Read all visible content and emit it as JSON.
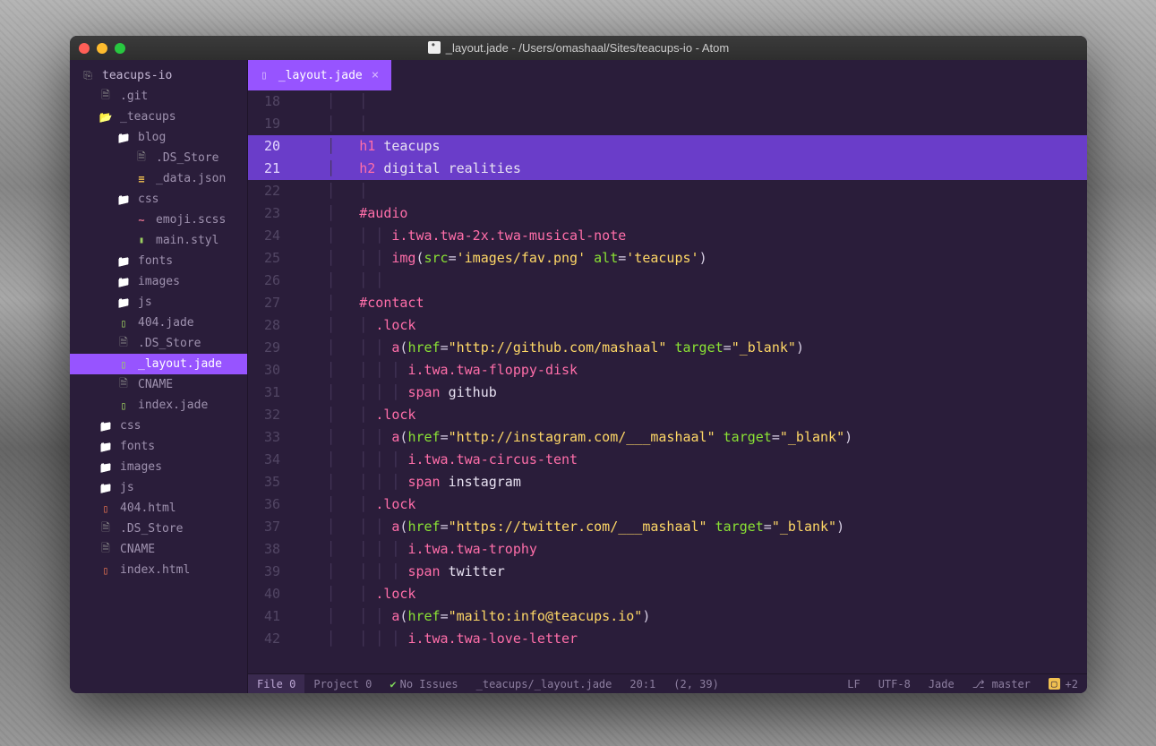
{
  "window": {
    "title": "_layout.jade - /Users/omashaal/Sites/teacups-io - Atom"
  },
  "sidebar": {
    "root": "teacups-io",
    "nodes": [
      {
        "depth": 2,
        "icon": "file-icon",
        "label": ".git"
      },
      {
        "depth": 2,
        "icon": "folder-open",
        "label": "_teacups"
      },
      {
        "depth": 3,
        "icon": "folder-icon",
        "label": "blog"
      },
      {
        "depth": 4,
        "icon": "file-icon",
        "label": ".DS_Store"
      },
      {
        "depth": 4,
        "icon": "db-icon",
        "label": "_data.json"
      },
      {
        "depth": 3,
        "icon": "folder-icon",
        "label": "css"
      },
      {
        "depth": 4,
        "icon": "scss-icon",
        "label": "emoji.scss"
      },
      {
        "depth": 4,
        "icon": "styl-icon",
        "label": "main.styl"
      },
      {
        "depth": 3,
        "icon": "folder-icon",
        "label": "fonts"
      },
      {
        "depth": 3,
        "icon": "folder-icon",
        "label": "images"
      },
      {
        "depth": 3,
        "icon": "folder-icon",
        "label": "js"
      },
      {
        "depth": 3,
        "icon": "jade-icon",
        "label": "404.jade"
      },
      {
        "depth": 3,
        "icon": "file-icon",
        "label": ".DS_Store"
      },
      {
        "depth": 3,
        "icon": "jade-icon",
        "label": "_layout.jade",
        "selected": true
      },
      {
        "depth": 3,
        "icon": "file-icon",
        "label": "CNAME"
      },
      {
        "depth": 3,
        "icon": "jade-icon",
        "label": "index.jade"
      },
      {
        "depth": 2,
        "icon": "folder-icon",
        "label": "css"
      },
      {
        "depth": 2,
        "icon": "folder-icon",
        "label": "fonts"
      },
      {
        "depth": 2,
        "icon": "folder-icon",
        "label": "images"
      },
      {
        "depth": 2,
        "icon": "folder-icon",
        "label": "js"
      },
      {
        "depth": 2,
        "icon": "html-icon",
        "label": "404.html"
      },
      {
        "depth": 2,
        "icon": "file-icon",
        "label": ".DS_Store"
      },
      {
        "depth": 2,
        "icon": "file-icon",
        "label": "CNAME"
      },
      {
        "depth": 2,
        "icon": "html-icon",
        "label": "index.html"
      }
    ]
  },
  "tab": {
    "label": "_layout.jade"
  },
  "code": {
    "first_line": 18,
    "lines": [
      {
        "n": 18,
        "segs": [
          {
            "c": "guide",
            "t": "    │   │"
          }
        ]
      },
      {
        "n": 19,
        "segs": [
          {
            "c": "guide",
            "t": "    │   │"
          }
        ]
      },
      {
        "n": 20,
        "hl": true,
        "segs": [
          {
            "c": "guide",
            "t": "    │   "
          },
          {
            "c": "tag",
            "t": "h1"
          },
          {
            "c": "txt",
            "t": " teacups"
          }
        ]
      },
      {
        "n": 21,
        "hl": true,
        "segs": [
          {
            "c": "guide",
            "t": "    │   "
          },
          {
            "c": "tag",
            "t": "h2"
          },
          {
            "c": "txt",
            "t": " digital realities"
          }
        ]
      },
      {
        "n": 22,
        "segs": [
          {
            "c": "guide",
            "t": "    │   │"
          }
        ]
      },
      {
        "n": 23,
        "segs": [
          {
            "c": "guide",
            "t": "    │   "
          },
          {
            "c": "id",
            "t": "#audio"
          }
        ]
      },
      {
        "n": 24,
        "segs": [
          {
            "c": "guide",
            "t": "    │   │ │ "
          },
          {
            "c": "cls",
            "t": "i.twa.twa-2x.twa-musical-note"
          }
        ]
      },
      {
        "n": 25,
        "segs": [
          {
            "c": "guide",
            "t": "    │   │ │ "
          },
          {
            "c": "tag",
            "t": "img"
          },
          {
            "c": "pn",
            "t": "("
          },
          {
            "c": "attr",
            "t": "src"
          },
          {
            "c": "eq",
            "t": "="
          },
          {
            "c": "str",
            "t": "'images/fav.png'"
          },
          {
            "c": "txt",
            "t": " "
          },
          {
            "c": "attr",
            "t": "alt"
          },
          {
            "c": "eq",
            "t": "="
          },
          {
            "c": "str",
            "t": "'teacups'"
          },
          {
            "c": "pn",
            "t": ")"
          }
        ]
      },
      {
        "n": 26,
        "segs": [
          {
            "c": "guide",
            "t": "    │   │ │"
          }
        ]
      },
      {
        "n": 27,
        "segs": [
          {
            "c": "guide",
            "t": "    │   "
          },
          {
            "c": "id",
            "t": "#contact"
          }
        ]
      },
      {
        "n": 28,
        "segs": [
          {
            "c": "guide",
            "t": "    │   │ "
          },
          {
            "c": "cls",
            "t": ".lock"
          }
        ]
      },
      {
        "n": 29,
        "segs": [
          {
            "c": "guide",
            "t": "    │   │ │ "
          },
          {
            "c": "tag",
            "t": "a"
          },
          {
            "c": "pn",
            "t": "("
          },
          {
            "c": "attr",
            "t": "href"
          },
          {
            "c": "eq",
            "t": "="
          },
          {
            "c": "str",
            "t": "\"http://github.com/mashaal\""
          },
          {
            "c": "txt",
            "t": " "
          },
          {
            "c": "attr",
            "t": "target"
          },
          {
            "c": "eq",
            "t": "="
          },
          {
            "c": "str",
            "t": "\"_blank\""
          },
          {
            "c": "pn",
            "t": ")"
          }
        ]
      },
      {
        "n": 30,
        "segs": [
          {
            "c": "guide",
            "t": "    │   │ │ │ "
          },
          {
            "c": "cls",
            "t": "i.twa.twa-floppy-disk"
          }
        ]
      },
      {
        "n": 31,
        "segs": [
          {
            "c": "guide",
            "t": "    │   │ │ │ "
          },
          {
            "c": "tag",
            "t": "span"
          },
          {
            "c": "txt",
            "t": " github"
          }
        ]
      },
      {
        "n": 32,
        "segs": [
          {
            "c": "guide",
            "t": "    │   │ "
          },
          {
            "c": "cls",
            "t": ".lock"
          }
        ]
      },
      {
        "n": 33,
        "segs": [
          {
            "c": "guide",
            "t": "    │   │ │ "
          },
          {
            "c": "tag",
            "t": "a"
          },
          {
            "c": "pn",
            "t": "("
          },
          {
            "c": "attr",
            "t": "href"
          },
          {
            "c": "eq",
            "t": "="
          },
          {
            "c": "str",
            "t": "\"http://instagram.com/___mashaal\""
          },
          {
            "c": "txt",
            "t": " "
          },
          {
            "c": "attr",
            "t": "target"
          },
          {
            "c": "eq",
            "t": "="
          },
          {
            "c": "str",
            "t": "\"_blank\""
          },
          {
            "c": "pn",
            "t": ")"
          }
        ]
      },
      {
        "n": 34,
        "segs": [
          {
            "c": "guide",
            "t": "    │   │ │ │ "
          },
          {
            "c": "cls",
            "t": "i.twa.twa-circus-tent"
          }
        ]
      },
      {
        "n": 35,
        "segs": [
          {
            "c": "guide",
            "t": "    │   │ │ │ "
          },
          {
            "c": "tag",
            "t": "span"
          },
          {
            "c": "txt",
            "t": " instagram"
          }
        ]
      },
      {
        "n": 36,
        "segs": [
          {
            "c": "guide",
            "t": "    │   │ "
          },
          {
            "c": "cls",
            "t": ".lock"
          }
        ]
      },
      {
        "n": 37,
        "segs": [
          {
            "c": "guide",
            "t": "    │   │ │ "
          },
          {
            "c": "tag",
            "t": "a"
          },
          {
            "c": "pn",
            "t": "("
          },
          {
            "c": "attr",
            "t": "href"
          },
          {
            "c": "eq",
            "t": "="
          },
          {
            "c": "str",
            "t": "\"https://twitter.com/___mashaal\""
          },
          {
            "c": "txt",
            "t": " "
          },
          {
            "c": "attr",
            "t": "target"
          },
          {
            "c": "eq",
            "t": "="
          },
          {
            "c": "str",
            "t": "\"_blank\""
          },
          {
            "c": "pn",
            "t": ")"
          }
        ]
      },
      {
        "n": 38,
        "segs": [
          {
            "c": "guide",
            "t": "    │   │ │ │ "
          },
          {
            "c": "cls",
            "t": "i.twa.twa-trophy"
          }
        ]
      },
      {
        "n": 39,
        "segs": [
          {
            "c": "guide",
            "t": "    │   │ │ │ "
          },
          {
            "c": "tag",
            "t": "span"
          },
          {
            "c": "txt",
            "t": " twitter"
          }
        ]
      },
      {
        "n": 40,
        "segs": [
          {
            "c": "guide",
            "t": "    │   │ "
          },
          {
            "c": "cls",
            "t": ".lock"
          }
        ]
      },
      {
        "n": 41,
        "segs": [
          {
            "c": "guide",
            "t": "    │   │ │ "
          },
          {
            "c": "tag",
            "t": "a"
          },
          {
            "c": "pn",
            "t": "("
          },
          {
            "c": "attr",
            "t": "href"
          },
          {
            "c": "eq",
            "t": "="
          },
          {
            "c": "str",
            "t": "\"mailto:info@teacups.io\""
          },
          {
            "c": "pn",
            "t": ")"
          }
        ]
      },
      {
        "n": 42,
        "segs": [
          {
            "c": "guide",
            "t": "    │   │ │ │ "
          },
          {
            "c": "cls",
            "t": "i.twa.twa-love-letter"
          }
        ]
      }
    ]
  },
  "status": {
    "file": "File  0",
    "project": "Project  0",
    "issues": "No Issues",
    "path": "_teacups/_layout.jade",
    "cursor": "20:1",
    "sel": "(2, 39)",
    "lf": "LF",
    "enc": "UTF-8",
    "lang": "Jade",
    "branch": "master",
    "plus": "+2"
  }
}
